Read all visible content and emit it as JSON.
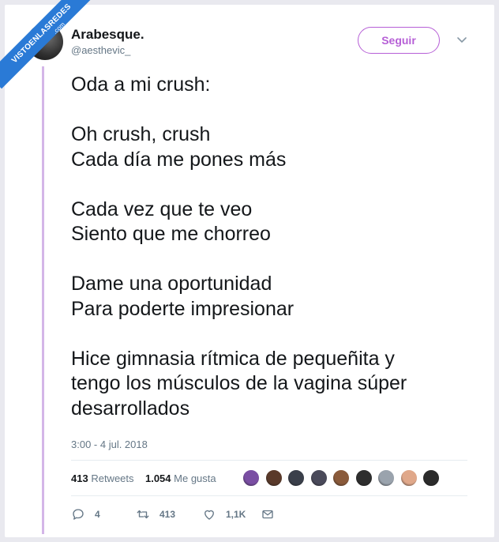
{
  "watermark": {
    "text": "VISTOENLASREDES",
    "suffix": ".com"
  },
  "user": {
    "name": "Arabesque.",
    "handle": "@aesthevic_"
  },
  "follow_label": "Seguir",
  "tweet": {
    "text": "Oda a mi crush:\n\nOh crush, crush\nCada día me pones más\n\nCada vez que te veo\nSiento que me chorreo\n\nDame una oportunidad\nPara poderte impresionar\n\nHice gimnasia rítmica de pequeñita y\ntengo los músculos de la vagina súper\ndesarrollados",
    "timestamp": "3:00 - 4 jul. 2018"
  },
  "stats": {
    "retweets_count": "413",
    "retweets_label": "Retweets",
    "likes_count": "1.054",
    "likes_label": "Me gusta"
  },
  "likers_colors": [
    "#7a4ea3",
    "#5a3a2a",
    "#3a3f4a",
    "#4a4a5a",
    "#8a5a3a",
    "#2e2e2e",
    "#9aa3ad",
    "#e0a88a",
    "#2b2b2b"
  ],
  "actions": {
    "replies": "4",
    "retweets": "413",
    "likes": "1,1K"
  },
  "colors": {
    "accent": "#b65fd6",
    "thread": "#d4b6e8",
    "ribbon": "#2a7ad6"
  }
}
